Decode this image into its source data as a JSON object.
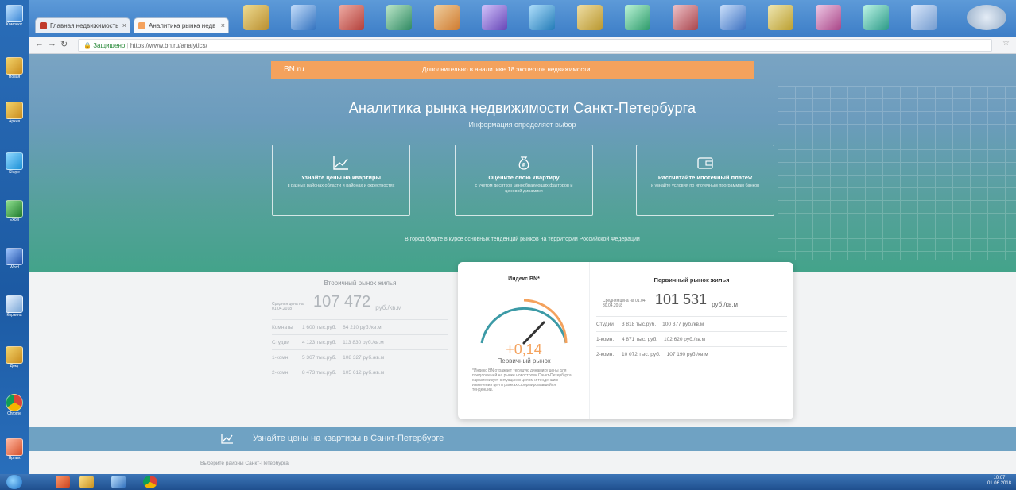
{
  "desktop": {
    "icons": [
      {
        "label": "Компьют"
      },
      {
        "label": "Новая"
      },
      {
        "label": "Архив"
      },
      {
        "label": "Skype"
      },
      {
        "label": "Excel"
      },
      {
        "label": "Word"
      },
      {
        "label": "Корзина"
      },
      {
        "label": "Доку"
      },
      {
        "label": "Chrome"
      },
      {
        "label": "Ярлык"
      }
    ]
  },
  "browser": {
    "tabs": [
      {
        "label": "Главная недвижимость",
        "favicon_color": "#c0392b",
        "active": false
      },
      {
        "label": "Аналитика рынка недв",
        "favicon_color": "#f4a25d",
        "active": true
      }
    ],
    "url_secure": "Защищено",
    "url": "https://www.bn.ru/analytics/"
  },
  "page": {
    "brand": "BN.ru",
    "orange_message": "Дополнительно в аналитике 18 экспертов недвижимости",
    "title": "Аналитика рынка недвижимости Санкт-Петербурга",
    "subtitle": "Информация определяет выбор",
    "features": [
      {
        "title": "Узнайте цены на квартиры",
        "desc": "в разных районах области и районах и окрестностях",
        "icon": "chart-icon"
      },
      {
        "title": "Оцените свою квартиру",
        "desc": "с учетом десятков ценообразующих факторов и ценовой динамики",
        "icon": "money-bag-icon"
      },
      {
        "title": "Рассчитайте ипотечный платеж",
        "desc": "и узнайте условия по ипотечным программам банков",
        "icon": "wallet-icon"
      }
    ],
    "hero_note": "В город будьте в курсе основных тенденций рынков на территории Российской Федерации",
    "secondary": {
      "title": "Вторичный рынок жилья",
      "avg_label": "Средняя цена на 01.04.2018",
      "avg_value": "107 472",
      "avg_unit": "руб./кв.м",
      "rows": [
        {
          "label": "Комнаты",
          "total": "1 600 тыс.руб.",
          "per_m": "84 210 руб./кв.м"
        },
        {
          "label": "Студии",
          "total": "4 123 тыс.руб.",
          "per_m": "113 830 руб./кв.м"
        },
        {
          "label": "1-комн.",
          "total": "5 367 тыс.руб.",
          "per_m": "108 327 руб./кв.м"
        },
        {
          "label": "2-комн.",
          "total": "8 473 тыс.руб.",
          "per_m": "105 612 руб./кв.м"
        }
      ]
    },
    "index": {
      "title": "Индекс BN*",
      "value": "+0,14",
      "market": "Первичный рынок",
      "description": "*Индекс BN отражает текущую динамику цены для предложений на рынке новостроек Санкт-Петербурга, характеризует ситуацию в целом и тенденцию изменения цен в рамках сформировавшейся тенденции."
    },
    "primary": {
      "title": "Первичный рынок жилья",
      "avg_label": "Средняя цена на 01.04-30.04.2018",
      "avg_value": "101 531",
      "avg_unit": "руб./кв.м",
      "rows": [
        {
          "label": "Студии",
          "total": "3 818 тыс.руб.",
          "per_m": "100 377 руб./кв.м"
        },
        {
          "label": "1-комн.",
          "total": "4 871 тыс. руб.",
          "per_m": "102 620 руб./кв.м"
        },
        {
          "label": "2-комн.",
          "total": "10 072 тыс. руб.",
          "per_m": "107 190 руб./кв.м"
        }
      ]
    },
    "cta_text": "Узнайте цены на квартиры в Санкт-Петербурге",
    "district_label": "Выберите районы Санкт-Петербурга"
  },
  "taskbar": {
    "clock_time": "10:07",
    "clock_date": "01.06.2018"
  }
}
